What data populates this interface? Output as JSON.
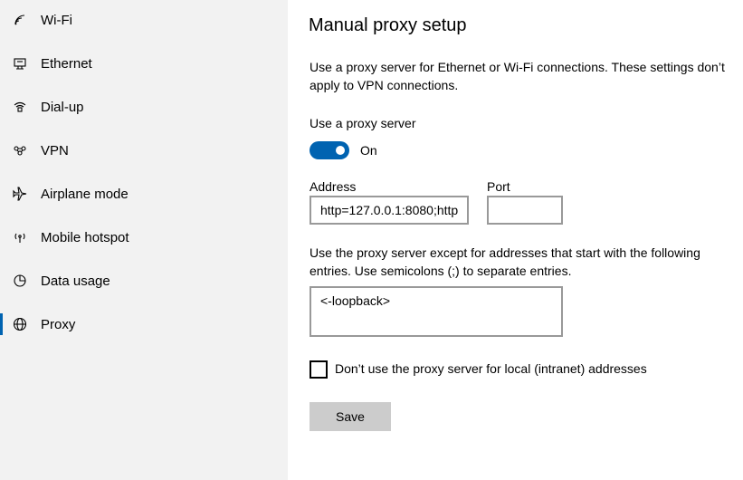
{
  "sidebar": {
    "items": [
      {
        "label": "Wi-Fi",
        "icon": "wifi-icon"
      },
      {
        "label": "Ethernet",
        "icon": "ethernet-icon"
      },
      {
        "label": "Dial-up",
        "icon": "dialup-icon"
      },
      {
        "label": "VPN",
        "icon": "vpn-icon"
      },
      {
        "label": "Airplane mode",
        "icon": "airplane-icon"
      },
      {
        "label": "Mobile hotspot",
        "icon": "hotspot-icon"
      },
      {
        "label": "Data usage",
        "icon": "data-usage-icon"
      },
      {
        "label": "Proxy",
        "icon": "globe-icon"
      }
    ],
    "selected": "Proxy"
  },
  "main": {
    "title": "Manual proxy setup",
    "description": "Use a proxy server for Ethernet or Wi-Fi connections. These settings don’t apply to VPN connections.",
    "use_proxy_label": "Use a proxy server",
    "toggle_state": "On",
    "address_label": "Address",
    "address_value": "http=127.0.0.1:8080;http",
    "port_label": "Port",
    "port_value": "",
    "exceptions_description": "Use the proxy server except for addresses that start with the following entries. Use semicolons (;) to separate entries.",
    "exceptions_value": "<-loopback>",
    "local_checkbox_label": "Don’t use the proxy server for local (intranet) addresses",
    "local_checkbox_checked": false,
    "save_label": "Save"
  },
  "colors": {
    "accent": "#0063b1",
    "sidebar_bg": "#f2f2f2",
    "button_bg": "#cccccc"
  }
}
